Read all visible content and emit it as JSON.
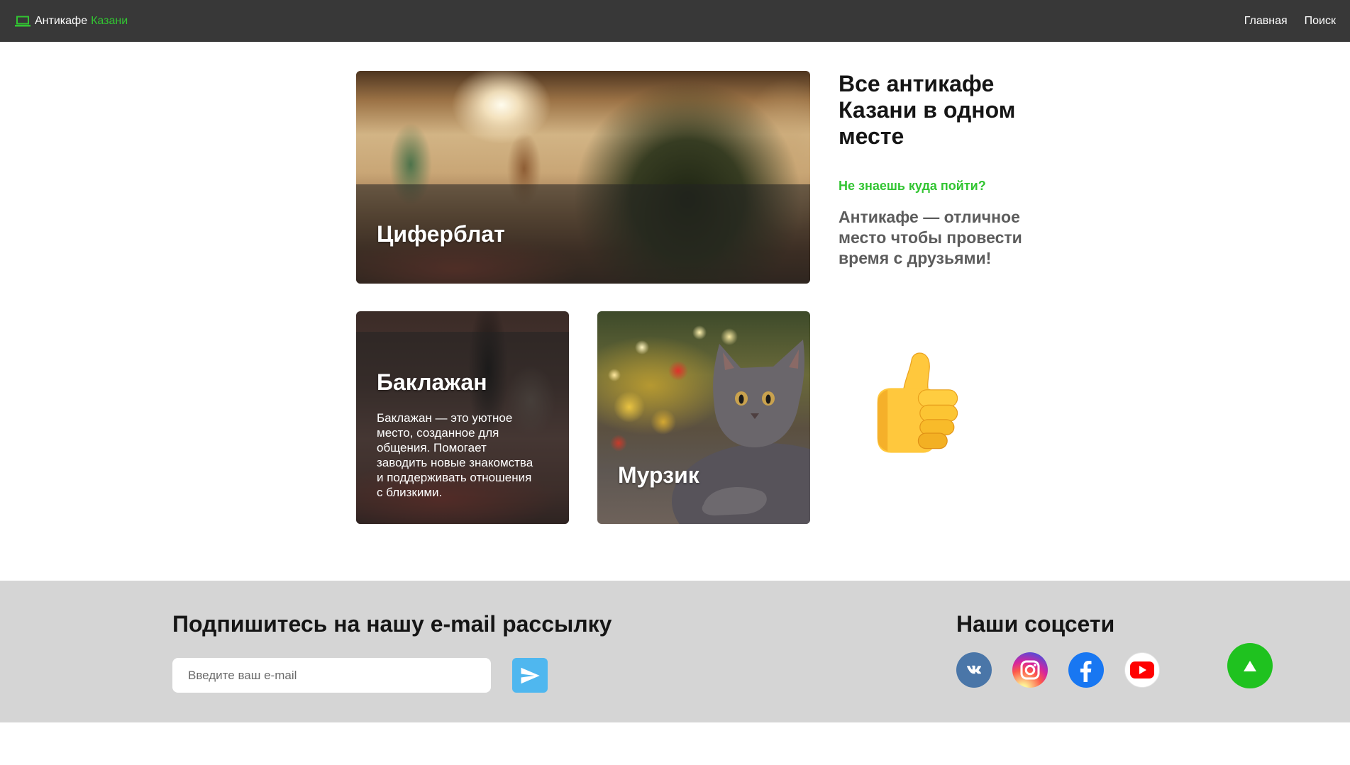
{
  "navbar": {
    "brand_icon": "laptop-icon",
    "brand_part1": "Антикафе",
    "brand_part2": "Казани",
    "links": [
      {
        "label": "Главная"
      },
      {
        "label": "Поиск"
      }
    ]
  },
  "cards": [
    {
      "title": "Циферблат"
    },
    {
      "title": "Баклажан",
      "description": "Баклажан — это уютное место, созданное для общения. Помогает заводить новые знакомства и поддерживать отношения с близкими."
    },
    {
      "title": "Мурзик"
    }
  ],
  "intro": {
    "heading": "Все антикафе Казани в одном месте",
    "tagline": "Не знаешь куда пойти?",
    "text": "Антикафе — отличное место чтобы провести время с друзьями!",
    "emoji_icon": "thumbs-up-icon"
  },
  "footer": {
    "subscribe_title": "Подпишитесь на нашу e-mail рассылку",
    "email_placeholder": "Введите ваш e-mail",
    "send_icon": "paper-plane-icon",
    "social_title": "Наши соцсети",
    "social_icons": [
      "vk-icon",
      "instagram-icon",
      "facebook-icon",
      "youtube-icon"
    ],
    "scroll_top_icon": "arrow-up-icon"
  },
  "colors": {
    "accent_green": "#32c532",
    "navbar_bg": "#383838",
    "footer_bg": "#d5d5d5",
    "send_button": "#4fb7ef",
    "scroll_top": "#1fc21f",
    "vk": "#4a76a8",
    "facebook": "#1877f2",
    "youtube": "#ff0000"
  }
}
